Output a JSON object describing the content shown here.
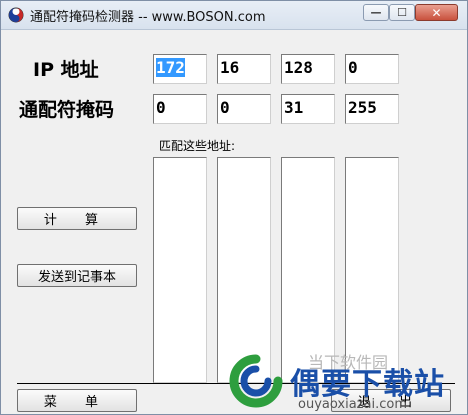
{
  "window": {
    "title": "通配符掩码检测器 -- www.BOSON.com",
    "minimize_glyph": "—",
    "maximize_glyph": "☐",
    "close_glyph": "✕"
  },
  "labels": {
    "ip_address": "IP 地址",
    "wildcard_mask": "通配符掩码",
    "match_caption": "匹配这些地址:"
  },
  "ip_octets": [
    "172",
    "16",
    "128",
    "0"
  ],
  "mask_octets": [
    "0",
    "0",
    "31",
    "255"
  ],
  "buttons": {
    "calculate": "计 算",
    "send_to_notepad": "发送到记事本",
    "menu": "菜 单",
    "exit": "退 出"
  },
  "watermark": {
    "brand": "偶要下载站",
    "faint_text": "当下软件园",
    "url": "ouyaoxiazai.com"
  },
  "colors": {
    "selection": "#3399ff",
    "brand_blue": "#1a4fa8"
  }
}
